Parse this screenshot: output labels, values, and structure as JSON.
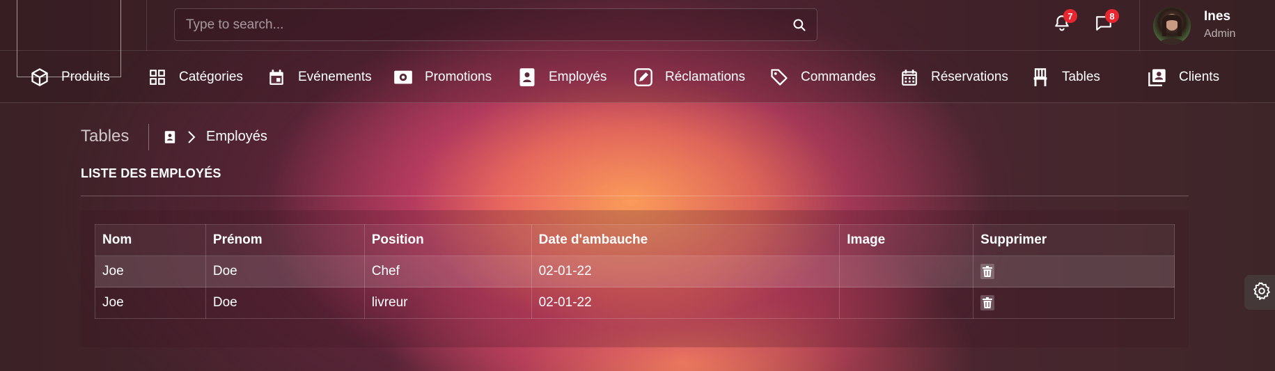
{
  "search": {
    "placeholder": "Type to search..."
  },
  "notifications": {
    "bell_count": "7",
    "messages_count": "8"
  },
  "user": {
    "name": "Ines",
    "role": "Admin"
  },
  "nav": {
    "items": [
      {
        "label": "Produits",
        "icon": "box-icon"
      },
      {
        "label": "Catégories",
        "icon": "grid-icon"
      },
      {
        "label": "Evénements",
        "icon": "calendar-icon"
      },
      {
        "label": "Promotions",
        "icon": "cash-icon"
      },
      {
        "label": "Employés",
        "icon": "badge-icon"
      },
      {
        "label": "Réclamations",
        "icon": "edit-icon"
      },
      {
        "label": "Commandes",
        "icon": "tag-icon"
      },
      {
        "label": "Réservations",
        "icon": "calendar-grid-icon"
      },
      {
        "label": "Tables",
        "icon": "chair-icon"
      },
      {
        "label": "Clients",
        "icon": "contacts-icon"
      }
    ]
  },
  "page": {
    "title": "Tables",
    "breadcrumb_current": "Employés",
    "section_title": "LISTE DES EMPLOYÉS"
  },
  "table": {
    "headers": [
      "Nom",
      "Prénom",
      "Position",
      "Date d'ambauche",
      "Image",
      "Supprimer"
    ],
    "rows": [
      {
        "nom": "Joe",
        "prenom": "Doe",
        "position": "Chef",
        "date": "02-01-22",
        "image": ""
      },
      {
        "nom": "Joe",
        "prenom": "Doe",
        "position": "livreur",
        "date": "02-01-22",
        "image": ""
      }
    ]
  },
  "colors": {
    "badge": "#e8262f",
    "accent_glow": "#ff9a5a"
  }
}
